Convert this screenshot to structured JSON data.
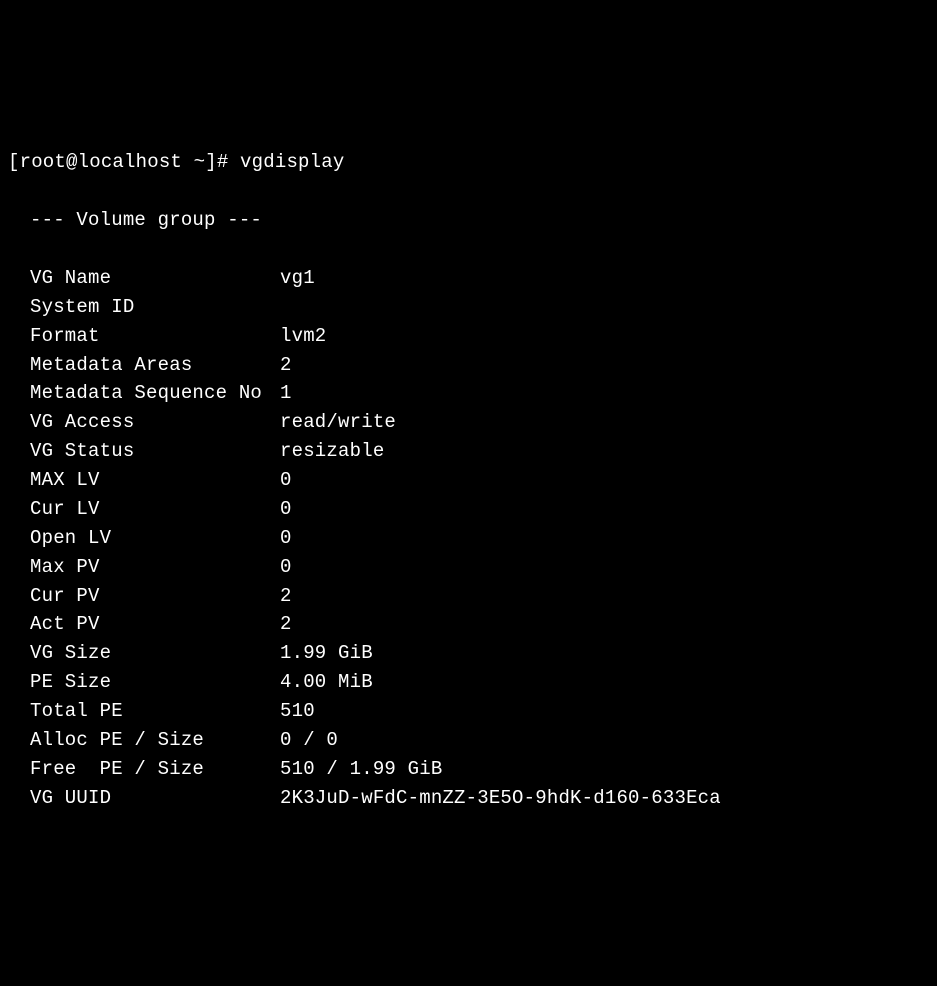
{
  "prompt": "[root@localhost ~]# ",
  "command": "vgdisplay",
  "header": "--- Volume group ---",
  "fields": [
    {
      "label": "VG Name",
      "value": "vg1"
    },
    {
      "label": "System ID",
      "value": ""
    },
    {
      "label": "Format",
      "value": "lvm2"
    },
    {
      "label": "Metadata Areas",
      "value": "2"
    },
    {
      "label": "Metadata Sequence No",
      "value": "1"
    },
    {
      "label": "VG Access",
      "value": "read/write"
    },
    {
      "label": "VG Status",
      "value": "resizable"
    },
    {
      "label": "MAX LV",
      "value": "0"
    },
    {
      "label": "Cur LV",
      "value": "0"
    },
    {
      "label": "Open LV",
      "value": "0"
    },
    {
      "label": "Max PV",
      "value": "0"
    },
    {
      "label": "Cur PV",
      "value": "2"
    },
    {
      "label": "Act PV",
      "value": "2"
    },
    {
      "label": "VG Size",
      "value": "1.99 GiB"
    },
    {
      "label": "PE Size",
      "value": "4.00 MiB"
    },
    {
      "label": "Total PE",
      "value": "510"
    },
    {
      "label": "Alloc PE / Size",
      "value": "0 / 0"
    },
    {
      "label": "Free  PE / Size",
      "value": "510 / 1.99 GiB"
    },
    {
      "label": "VG UUID",
      "value": "2K3JuD-wFdC-mnZZ-3E5O-9hdK-d160-633Eca"
    }
  ]
}
